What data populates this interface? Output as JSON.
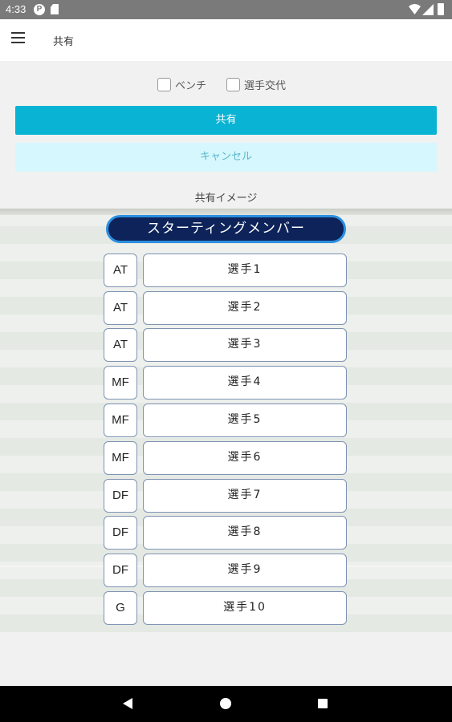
{
  "status": {
    "time": "4:33",
    "icons": [
      "p-notification-icon",
      "sd-card-icon",
      "wifi-icon",
      "signal-icon",
      "battery-icon"
    ]
  },
  "appbar": {
    "title": "共有",
    "menu_icon": "hamburger-menu-icon"
  },
  "options": {
    "bench_label": "ベンチ",
    "bench_checked": false,
    "substitution_label": "選手交代",
    "substitution_checked": false
  },
  "buttons": {
    "share_label": "共有",
    "cancel_label": "キャンセル"
  },
  "preview": {
    "label": "共有イメージ",
    "header": "スターティングメンバー",
    "players": [
      {
        "position": "AT",
        "name": "選手1"
      },
      {
        "position": "AT",
        "name": "選手2"
      },
      {
        "position": "AT",
        "name": "選手3"
      },
      {
        "position": "MF",
        "name": "選手4"
      },
      {
        "position": "MF",
        "name": "選手5"
      },
      {
        "position": "MF",
        "name": "選手6"
      },
      {
        "position": "DF",
        "name": "選手7"
      },
      {
        "position": "DF",
        "name": "選手8"
      },
      {
        "position": "DF",
        "name": "選手9"
      },
      {
        "position": "G",
        "name": "選手10"
      }
    ]
  },
  "colors": {
    "accent": "#09b3d3",
    "cancel_bg": "#d5f7fd",
    "header_pill": "#0d2359",
    "header_border": "#2a8fe0"
  },
  "navbar": {
    "icons": [
      "back-icon",
      "home-icon",
      "recents-icon"
    ]
  }
}
